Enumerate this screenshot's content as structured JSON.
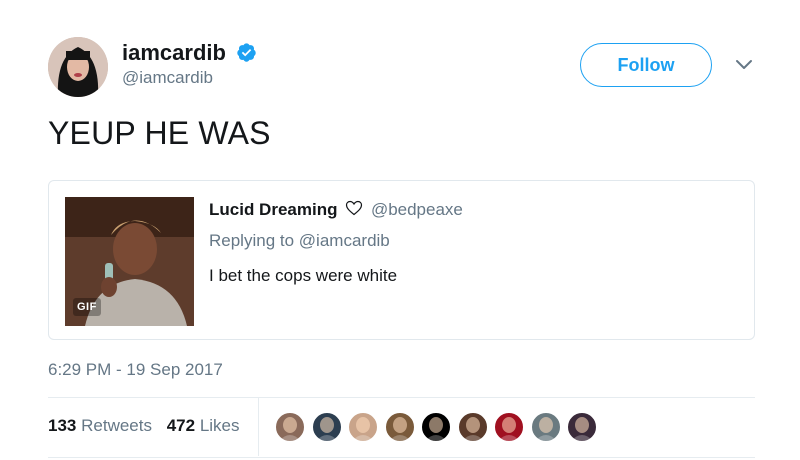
{
  "author": {
    "name": "iamcardib",
    "handle": "@iamcardib",
    "verified": true,
    "follow_label": "Follow"
  },
  "tweet": {
    "text": "YEUP HE WAS",
    "timestamp": "6:29 PM - 19 Sep 2017"
  },
  "quoted_tweet": {
    "name": "Lucid Dreaming",
    "handle": "@bedpeaxe",
    "replying_label": "Replying to",
    "replying_to": "@iamcardib",
    "text": "I bet the cops were white",
    "media_badge": "GIF"
  },
  "stats": {
    "retweets_count": "133",
    "retweets_label": "Retweets",
    "likes_count": "472",
    "likes_label": "Likes"
  },
  "likers": [
    {
      "name": "liker-1",
      "color": "#8a6a5a"
    },
    {
      "name": "liker-2",
      "color": "#2c3e50"
    },
    {
      "name": "liker-3",
      "color": "#c9a48a"
    },
    {
      "name": "liker-4",
      "color": "#7a5a3a"
    },
    {
      "name": "liker-5",
      "color": "#000000"
    },
    {
      "name": "liker-6",
      "color": "#5a3a2a"
    },
    {
      "name": "liker-7",
      "color": "#a01020"
    },
    {
      "name": "liker-8",
      "color": "#6a7a80"
    },
    {
      "name": "liker-9",
      "color": "#3a2a3a"
    }
  ],
  "colors": {
    "accent": "#1da1f2",
    "secondary_text": "#657786",
    "primary_text": "#14171a"
  }
}
